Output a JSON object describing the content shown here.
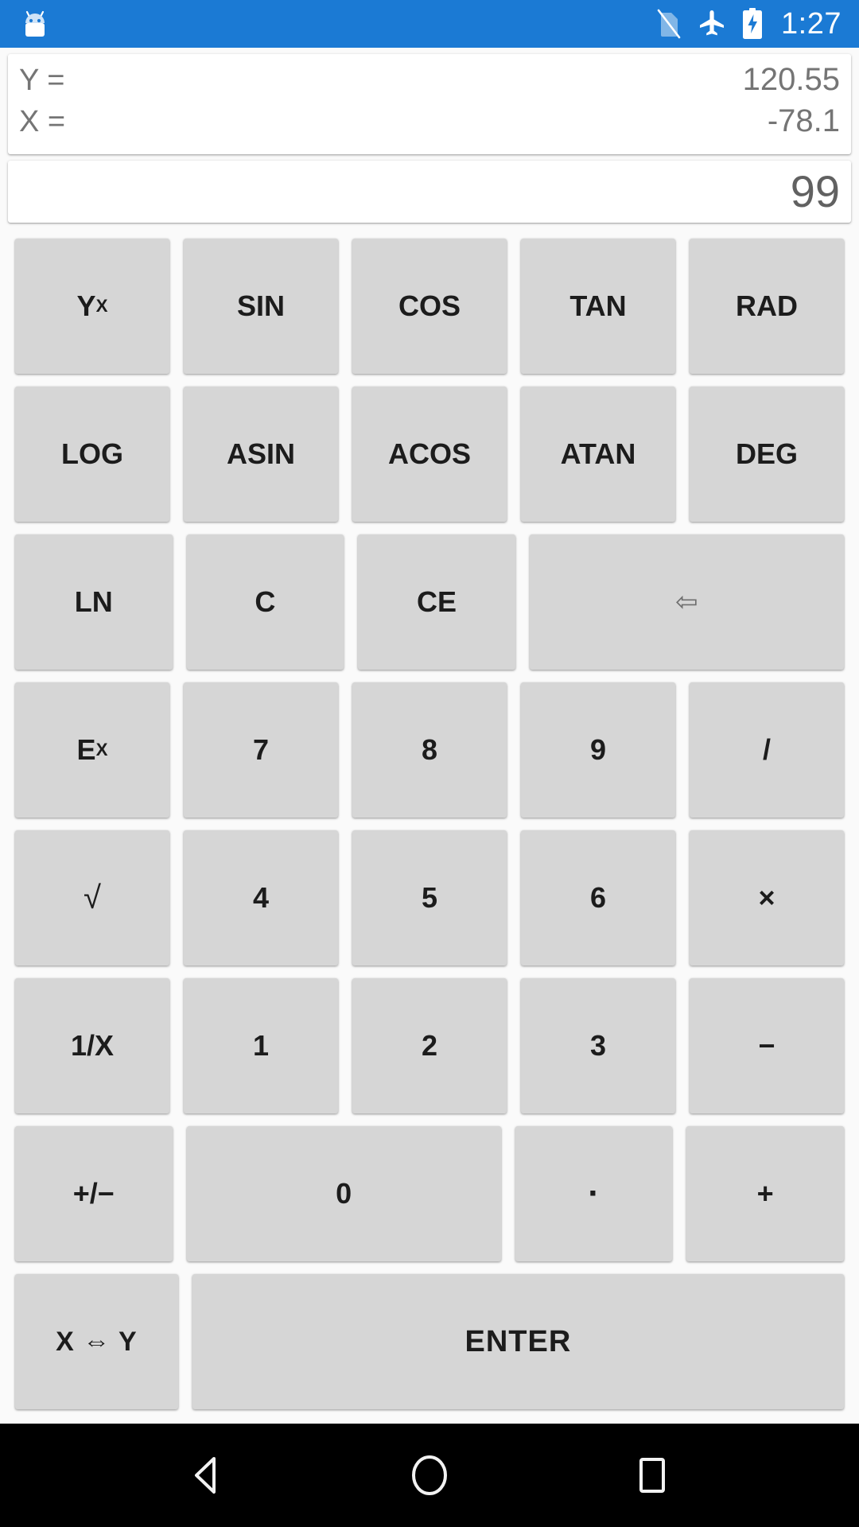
{
  "status_bar": {
    "background_color": "#1b7ad4",
    "app_icon": "android-robot-icon",
    "icons": [
      "no-sim-icon",
      "airplane-mode-icon",
      "battery-charging-icon"
    ],
    "clock": "1:27"
  },
  "display": {
    "stack": [
      {
        "label": "Y =",
        "value": "120.55"
      },
      {
        "label": "X =",
        "value": "-78.1"
      }
    ],
    "entry_value": "99"
  },
  "keypad": {
    "rows": [
      [
        {
          "name": "y-to-x-power",
          "base": "Y",
          "sup": "X"
        },
        {
          "name": "sin",
          "label": "SIN"
        },
        {
          "name": "cos",
          "label": "COS"
        },
        {
          "name": "tan",
          "label": "TAN"
        },
        {
          "name": "rad",
          "label": "RAD"
        }
      ],
      [
        {
          "name": "log",
          "label": "LOG"
        },
        {
          "name": "asin",
          "label": "ASIN"
        },
        {
          "name": "acos",
          "label": "ACOS"
        },
        {
          "name": "atan",
          "label": "ATAN"
        },
        {
          "name": "deg",
          "label": "DEG"
        }
      ],
      [
        {
          "name": "ln",
          "label": "LN"
        },
        {
          "name": "clear",
          "label": "C"
        },
        {
          "name": "clear-entry",
          "label": "CE"
        },
        {
          "name": "backspace",
          "label": "⇦",
          "span": 2
        }
      ],
      [
        {
          "name": "e-to-x-power",
          "base": "E",
          "sup": "X"
        },
        {
          "name": "digit-7",
          "label": "7"
        },
        {
          "name": "digit-8",
          "label": "8"
        },
        {
          "name": "digit-9",
          "label": "9"
        },
        {
          "name": "divide",
          "label": "/"
        }
      ],
      [
        {
          "name": "square-root",
          "label": "√"
        },
        {
          "name": "digit-4",
          "label": "4"
        },
        {
          "name": "digit-5",
          "label": "5"
        },
        {
          "name": "digit-6",
          "label": "6"
        },
        {
          "name": "multiply",
          "label": "×"
        }
      ],
      [
        {
          "name": "reciprocal",
          "label": "1/X"
        },
        {
          "name": "digit-1",
          "label": "1"
        },
        {
          "name": "digit-2",
          "label": "2"
        },
        {
          "name": "digit-3",
          "label": "3"
        },
        {
          "name": "subtract",
          "label": "−"
        }
      ],
      [
        {
          "name": "sign-toggle",
          "label": "+/−"
        },
        {
          "name": "digit-0",
          "label": "0",
          "span": 2
        },
        {
          "name": "decimal-point",
          "label": "·"
        },
        {
          "name": "add",
          "label": "+"
        }
      ],
      [
        {
          "name": "swap-x-y",
          "label": "X ⇔ Y"
        },
        {
          "name": "enter",
          "label": "ENTER",
          "span": 4
        }
      ]
    ]
  },
  "nav_bar": {
    "background_color": "#000000",
    "buttons": [
      {
        "name": "back-icon"
      },
      {
        "name": "home-icon"
      },
      {
        "name": "recents-icon"
      }
    ]
  },
  "colors": {
    "status_bar": "#1b7ad4",
    "key_face": "#d6d6d6",
    "page_background": "#fafafa",
    "display_background": "#ffffff",
    "display_text": "#757575"
  }
}
